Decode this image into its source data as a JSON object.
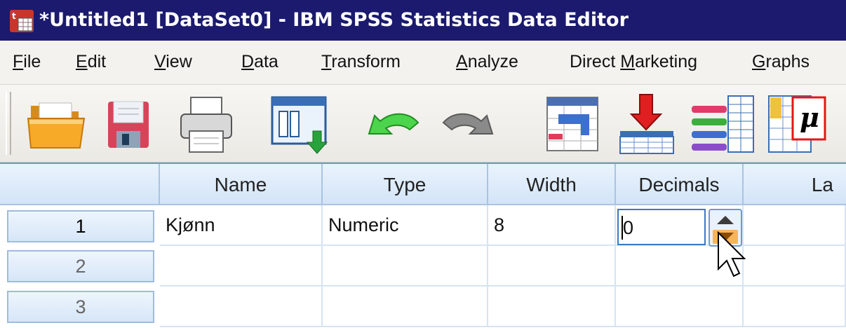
{
  "window": {
    "title": "*Untitled1 [DataSet0] - IBM SPSS Statistics Data Editor",
    "icon": "spss-app-icon"
  },
  "menu": [
    {
      "label": "File",
      "mnemonic": "F",
      "rest": "ile"
    },
    {
      "label": "Edit",
      "mnemonic": "E",
      "rest": "dit"
    },
    {
      "label": "View",
      "mnemonic": "V",
      "rest": "iew"
    },
    {
      "label": "Data",
      "mnemonic": "D",
      "rest": "ata"
    },
    {
      "label": "Transform",
      "mnemonic": "T",
      "rest": "ransform"
    },
    {
      "label": "Analyze",
      "mnemonic": "A",
      "rest": "nalyze"
    },
    {
      "label": "Direct Marketing",
      "pre": "Direct ",
      "mnemonic": "M",
      "rest": "arketing"
    },
    {
      "label": "Graphs",
      "mnemonic": "G",
      "rest": "raphs"
    }
  ],
  "toolbar": [
    "open-folder-icon",
    "save-icon",
    "print-icon",
    "recall-dialog-icon",
    "undo-icon",
    "redo-icon",
    "goto-case-icon",
    "insert-cases-icon",
    "variables-icon",
    "value-labels-icon"
  ],
  "grid": {
    "columns": [
      "",
      "Name",
      "Type",
      "Width",
      "Decimals",
      "La"
    ],
    "rows": [
      {
        "num": "1",
        "name": "Kjønn",
        "type": "Numeric",
        "width": "8",
        "decimals": "0"
      },
      {
        "num": "2",
        "name": "",
        "type": "",
        "width": "",
        "decimals": ""
      },
      {
        "num": "3",
        "name": "",
        "type": "",
        "width": "",
        "decimals": ""
      }
    ],
    "editor_value": "0"
  },
  "colors": {
    "title_bar": "#1b1a6f",
    "header": "#d3e4f7",
    "selection_border": "#3a78c6"
  }
}
